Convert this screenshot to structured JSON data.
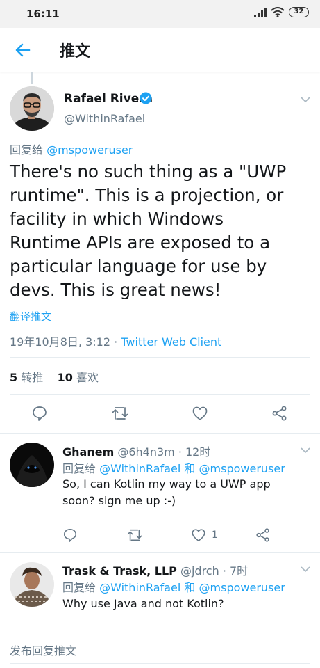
{
  "status_bar": {
    "time": "16:11",
    "battery": "32"
  },
  "app_bar": {
    "title": "推文"
  },
  "tweet": {
    "author_name": "Rafael Rivera",
    "author_handle": "@WithinRafael",
    "reply_prefix": "回复给",
    "reply_mention": "@mspoweruser",
    "text": "There's no such thing as a \"UWP runtime\". This is a projection, or facility in which Windows Runtime APIs are exposed to a particular language for use by devs. This is great news!",
    "translate_label": "翻译推文",
    "timestamp": "19年10月8日, 3:12 · ",
    "client": "Twitter Web Client",
    "retweets_count": "5",
    "retweets_label": "转推",
    "likes_count": "10",
    "likes_label": "喜欢"
  },
  "replies": [
    {
      "name": "Ghanem",
      "handle": "@6h4n3m",
      "time": "· 12时",
      "reply_prefix": "回复给",
      "mention1": "@WithinRafael",
      "conj": "和",
      "mention2": "@mspoweruser",
      "text": "So, I can Kotlin my way to a UWP app soon? sign me up :-)",
      "like_count": "1"
    },
    {
      "name": "Trask & Trask, LLP",
      "handle": "@jdrch",
      "time": "· 7时",
      "reply_prefix": "回复给",
      "mention1": "@WithinRafael",
      "conj": "和",
      "mention2": "@mspoweruser",
      "text": "Why use Java and not Kotlin?"
    }
  ],
  "compose": {
    "placeholder": "发布回复推文"
  },
  "colors": {
    "accent": "#1da1f2",
    "secondary_text": "#657786",
    "divider": "#e6ecf0"
  }
}
